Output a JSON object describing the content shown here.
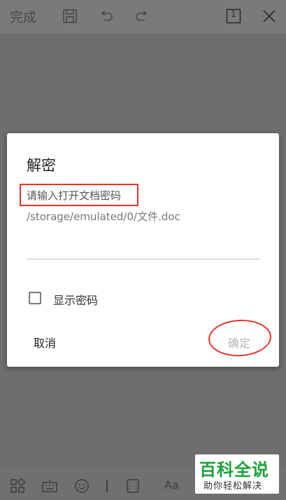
{
  "toolbar": {
    "done_label": "完成",
    "page_number": "1",
    "icons": [
      "save-icon",
      "undo-icon",
      "redo-icon",
      "page-count-icon",
      "close-icon"
    ]
  },
  "dialog": {
    "title": "解密",
    "prompt": "请输入打开文档密码",
    "file_path": "/storage/emulated/0/文件.doc",
    "password_value": "",
    "show_password_label": "显示密码",
    "show_password_checked": false,
    "cancel_label": "取消",
    "confirm_label": "确定"
  },
  "bottom_toolbar": {
    "icons": [
      "grid-icon",
      "keyboard-icon",
      "emoji-icon",
      "divider",
      "frame-icon",
      "text-style-icon"
    ],
    "text_style_label": "Aa"
  },
  "watermark": {
    "title": "百科全说",
    "subtitle": "助你轻松解决"
  },
  "colors": {
    "highlight_red": "#e5332a",
    "watermark_green": "#1aa23a",
    "confirm_disabled": "#b5b5b5"
  }
}
